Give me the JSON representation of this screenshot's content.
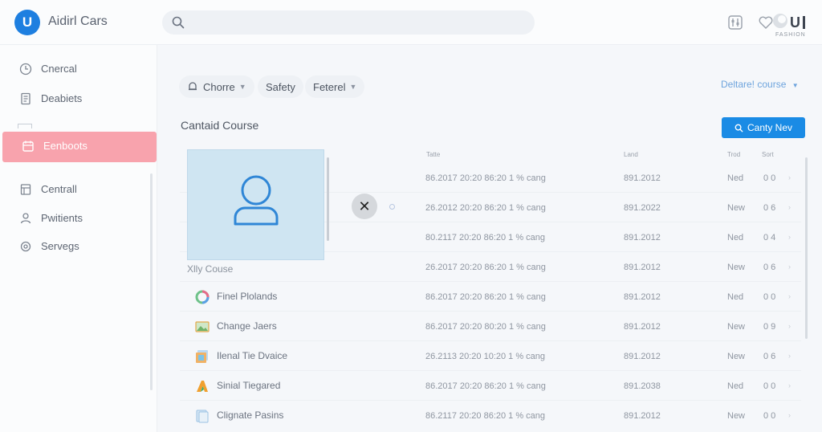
{
  "app": {
    "logo_letter": "U",
    "title": "Aidirl Cars"
  },
  "watermark": {
    "text": "FASHION"
  },
  "sidebar": {
    "items": [
      {
        "label": "Cnercal",
        "icon": "clock-icon"
      },
      {
        "label": "Deabiets",
        "icon": "document-icon"
      },
      {
        "label": "Eenboots",
        "icon": "calendar-icon",
        "active": true
      },
      {
        "label": "Centrall",
        "icon": "file-icon"
      },
      {
        "label": "Pwitients",
        "icon": "user-icon"
      },
      {
        "label": "Servegs",
        "icon": "gear-icon"
      }
    ]
  },
  "filters": {
    "chips": [
      {
        "label": "Chorre",
        "has_icon": true,
        "has_chevron": true
      },
      {
        "label": "Safety",
        "has_icon": false,
        "has_chevron": false
      },
      {
        "label": "Feterel",
        "has_icon": false,
        "has_chevron": true
      }
    ],
    "default_course": "Deltare! course"
  },
  "section": {
    "title": "Cantaid Course",
    "primary_button": "Canty Nev"
  },
  "table": {
    "headers": [
      "Tatte",
      "Land",
      "Trod",
      "Sort"
    ],
    "rows": [
      {
        "name": "",
        "time": "86.2017 20:20 86:20 1 % cang",
        "land": "891.2012",
        "status": "Ned",
        "value": "0 0"
      },
      {
        "name": "",
        "time": "26.2012 20:20 86:20 1 % cang",
        "land": "891.2022",
        "status": "New",
        "value": "0 6"
      },
      {
        "name": "",
        "time": "80.2117 20:20 86:20 1 % cang",
        "land": "891.2012",
        "status": "Ned",
        "value": "0 4"
      },
      {
        "name": "Xlly Couse",
        "time": "26.2017 20:20 86:20 1 % cang",
        "land": "891.2012",
        "status": "New",
        "value": "0 6"
      },
      {
        "name": "Finel Plolands",
        "time": "86.2017 20:20 86:20 1 % cang",
        "land": "891.2012",
        "status": "Ned",
        "value": "0 0"
      },
      {
        "name": "Change Jaers",
        "time": "86.2017 20:20 80:20 1 % cang",
        "land": "891.2012",
        "status": "New",
        "value": "0 9"
      },
      {
        "name": "Ilenal Tie Dvaice",
        "time": "26.2113 20:20 10:20 1 % cang",
        "land": "891.2012",
        "status": "New",
        "value": "0 6"
      },
      {
        "name": "Sinial Tiegared",
        "time": "86.2017 20:20 86:20 1 % cang",
        "land": "891.2038",
        "status": "Ned",
        "value": "0 0"
      },
      {
        "name": "Clignate Pasins",
        "time": "86.2117 20:20 86:20 1 % cang",
        "land": "891.2012",
        "status": "New",
        "value": "0 0"
      }
    ]
  },
  "colors": {
    "accent": "#1a8be5",
    "active_nav": "#f8a3ad",
    "card": "#cfe5f2"
  }
}
